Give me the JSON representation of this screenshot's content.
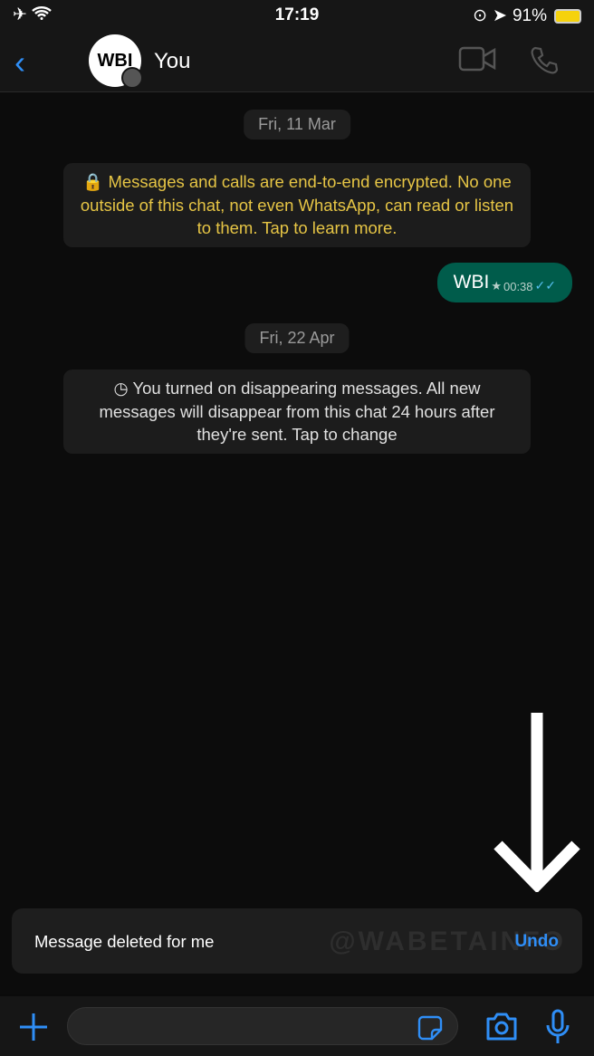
{
  "status": {
    "time": "17:19",
    "battery": "91%",
    "icons": [
      "airplane-icon",
      "wifi-icon",
      "rotation-lock-icon",
      "location-icon",
      "battery-charging-icon"
    ]
  },
  "header": {
    "contact_name": "You",
    "avatar_logo_text": "WBI"
  },
  "chat": {
    "dates": [
      "Fri, 11 Mar",
      "Fri, 22 Apr"
    ],
    "encryption_notice": "Messages and calls are end-to-end encrypted. No one outside of this chat, not even WhatsApp, can read or listen to them. Tap to learn more.",
    "disappearing_notice": "You turned on disappearing messages. All new messages will disappear from this chat 24 hours after they're sent. Tap to change",
    "messages": [
      {
        "text": "WBI",
        "time": "00:38",
        "starred": true,
        "status": "read"
      }
    ]
  },
  "toast": {
    "message": "Message deleted for me",
    "action": "Undo",
    "watermark": "@WABETAINFO"
  },
  "colors": {
    "accent": "#2f8ef6",
    "outgoing_bubble": "#005c4b",
    "encryption_text": "#e6c545"
  }
}
